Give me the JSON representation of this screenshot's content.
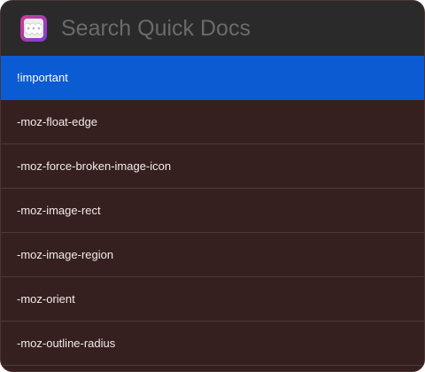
{
  "search": {
    "placeholder": "Search Quick Docs",
    "value": ""
  },
  "app_icon": "quick-docs-app-icon",
  "colors": {
    "selected": "#0b5bd3",
    "list_background": "#36201f",
    "search_background": "#2a2a2b"
  },
  "results": [
    {
      "label": "!important",
      "selected": true
    },
    {
      "label": "-moz-float-edge",
      "selected": false
    },
    {
      "label": "-moz-force-broken-image-icon",
      "selected": false
    },
    {
      "label": "-moz-image-rect",
      "selected": false
    },
    {
      "label": "-moz-image-region",
      "selected": false
    },
    {
      "label": "-moz-orient",
      "selected": false
    },
    {
      "label": "-moz-outline-radius",
      "selected": false
    }
  ]
}
